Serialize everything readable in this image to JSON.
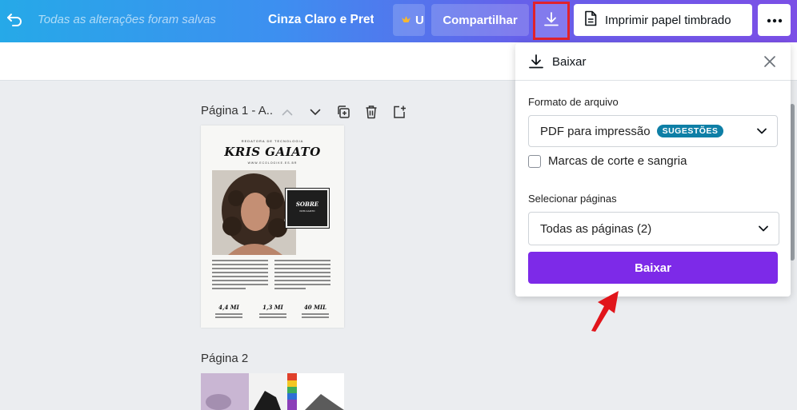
{
  "topbar": {
    "saved_status": "Todas as alterações foram salvas",
    "doc_title": "Cinza Claro e Pret...",
    "upgrade_label": "U",
    "share_label": "Compartilhar",
    "print_label": "Imprimir papel timbrado"
  },
  "canvas": {
    "page1_label": "Página 1 - A..",
    "page2_label": "Página 2",
    "page1": {
      "kicker": "REDATORA DE TECNOLOGIA",
      "name": "KRIS GAIATO",
      "subtitle": "WWW.ECOLOGIKE.ES.BR",
      "sobre": "SOBRE",
      "sobre_sub": "KRIS GAIATO",
      "stats": [
        {
          "num": "4,4 MI"
        },
        {
          "num": "1,3 MI"
        },
        {
          "num": "40 MIL"
        }
      ]
    }
  },
  "download_panel": {
    "title": "Baixar",
    "file_format_label": "Formato de arquivo",
    "file_format_value": "PDF para impressão",
    "file_format_badge": "SUGESTÕES",
    "crop_marks_label": "Marcas de corte e sangria",
    "pages_label": "Selecionar páginas",
    "pages_value": "Todas as páginas (2)",
    "download_button": "Baixar"
  },
  "colors": {
    "accent_purple": "#7d2ae8",
    "highlight_red": "#e1222b",
    "badge_teal": "#0e7fa6"
  }
}
